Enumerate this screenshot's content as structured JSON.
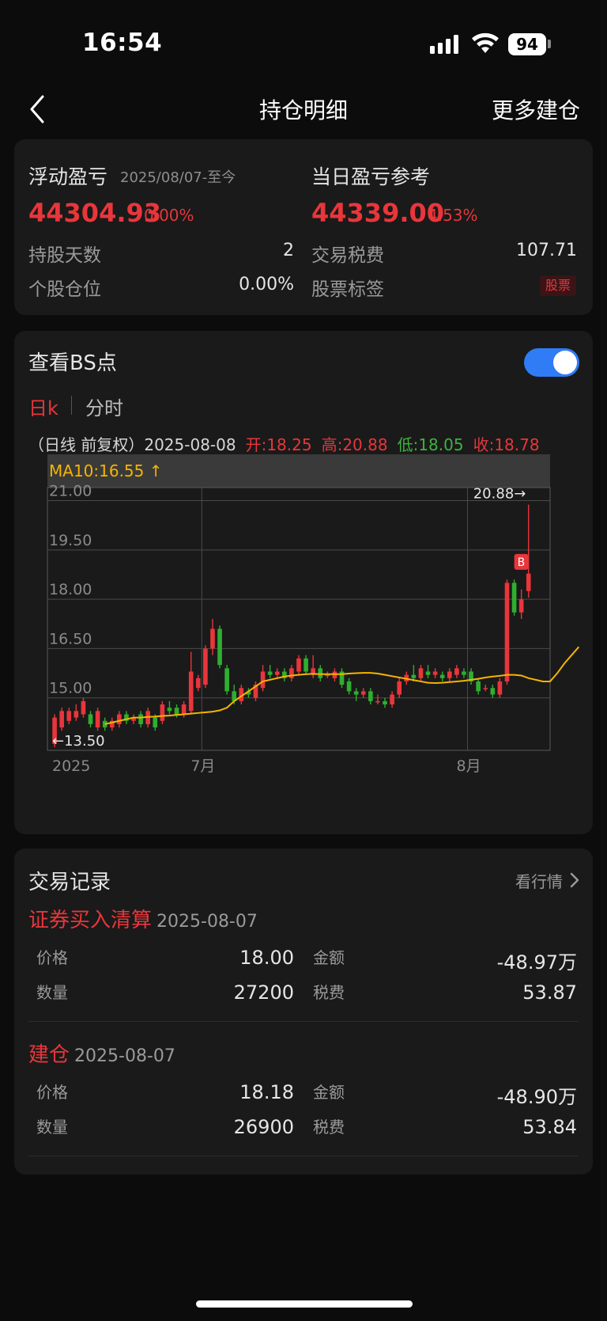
{
  "status": {
    "time": "16:54",
    "battery": "94"
  },
  "nav": {
    "title": "持仓明细",
    "right": "更多建仓"
  },
  "summary": {
    "floating_label": "浮动盈亏",
    "floating_since": "2025/08/07-至今",
    "floating_value": "44304.93",
    "floating_pct": "0.00%",
    "daily_label": "当日盈亏参考",
    "daily_value": "44339.00",
    "daily_pct": "4.53%",
    "hold_days_label": "持股天数",
    "hold_days_value": "2",
    "tax_label": "交易税费",
    "tax_value": "107.71",
    "position_label": "个股仓位",
    "position_value": "0.00%",
    "tag_label": "股票标签",
    "tag_value": "股票"
  },
  "bs": {
    "title": "查看BS点",
    "toggle_on": true,
    "tab_day": "日k",
    "tab_min": "分时",
    "ohlc_date": "（日线 前复权）2025-08-08",
    "open": "开:18.25",
    "high": "高:20.88",
    "low": "低:18.05",
    "close": "收:18.78"
  },
  "chart_data": {
    "type": "candlestick",
    "ma_label": "MA10:16.55 ↑",
    "y_ticks": [
      "21.00",
      "19.50",
      "18.00",
      "16.50",
      "15.00"
    ],
    "x_labels": [
      "2025",
      "7月",
      "8月"
    ],
    "ylim": [
      13.5,
      21.35
    ],
    "high_annotation": "20.88→",
    "low_annotation": "←13.50",
    "buy_marker": "B",
    "colors": {
      "up": "#e8363b",
      "down": "#2fae2f",
      "ma": "#f5b400"
    },
    "candles": [
      [
        13.6,
        14.4,
        13.5,
        14.5
      ],
      [
        14.1,
        14.6,
        14.0,
        14.7
      ],
      [
        14.3,
        14.6,
        14.2,
        14.7
      ],
      [
        14.4,
        14.6,
        14.3,
        14.8
      ],
      [
        14.5,
        14.9,
        14.4,
        15.0
      ],
      [
        14.5,
        14.2,
        14.1,
        14.6
      ],
      [
        14.1,
        14.6,
        14.0,
        14.7
      ],
      [
        14.3,
        14.1,
        14.0,
        14.4
      ],
      [
        14.1,
        14.3,
        14.0,
        14.4
      ],
      [
        14.2,
        14.5,
        14.1,
        14.6
      ],
      [
        14.5,
        14.3,
        14.2,
        14.6
      ],
      [
        14.3,
        14.4,
        14.2,
        14.5
      ],
      [
        14.5,
        14.2,
        14.1,
        14.6
      ],
      [
        14.2,
        14.6,
        14.1,
        14.7
      ],
      [
        14.4,
        14.1,
        14.0,
        14.5
      ],
      [
        14.3,
        14.8,
        14.2,
        14.9
      ],
      [
        14.7,
        14.6,
        14.5,
        14.9
      ],
      [
        14.7,
        14.5,
        14.4,
        14.8
      ],
      [
        14.5,
        14.8,
        14.4,
        14.9
      ],
      [
        14.6,
        15.8,
        14.5,
        16.4
      ],
      [
        15.3,
        15.6,
        15.2,
        15.7
      ],
      [
        15.4,
        16.5,
        15.3,
        16.6
      ],
      [
        16.5,
        17.1,
        16.3,
        17.4
      ],
      [
        17.1,
        16.0,
        15.9,
        17.2
      ],
      [
        15.9,
        15.2,
        15.1,
        16.0
      ],
      [
        15.2,
        14.9,
        14.8,
        15.4
      ],
      [
        14.9,
        15.3,
        14.8,
        15.4
      ],
      [
        15.2,
        15.1,
        15.0,
        15.3
      ],
      [
        15.0,
        15.4,
        14.9,
        15.5
      ],
      [
        15.3,
        15.8,
        15.2,
        16.0
      ],
      [
        15.8,
        15.7,
        15.6,
        16.0
      ],
      [
        15.7,
        15.8,
        15.6,
        15.9
      ],
      [
        15.8,
        15.6,
        15.5,
        15.9
      ],
      [
        15.6,
        15.9,
        15.5,
        16.0
      ],
      [
        15.8,
        16.2,
        15.7,
        16.3
      ],
      [
        16.2,
        15.8,
        15.7,
        16.3
      ],
      [
        15.7,
        15.9,
        15.6,
        16.3
      ],
      [
        15.9,
        15.6,
        15.5,
        16.0
      ],
      [
        15.7,
        15.7,
        15.6,
        15.8
      ],
      [
        15.6,
        15.8,
        15.5,
        15.9
      ],
      [
        15.8,
        15.4,
        15.3,
        15.9
      ],
      [
        15.5,
        15.2,
        15.1,
        15.6
      ],
      [
        15.2,
        15.1,
        14.9,
        15.3
      ],
      [
        15.1,
        15.2,
        15.0,
        15.3
      ],
      [
        15.2,
        14.9,
        14.8,
        15.3
      ],
      [
        14.9,
        14.9,
        14.8,
        15.1
      ],
      [
        14.9,
        14.8,
        14.7,
        15.0
      ],
      [
        14.8,
        15.1,
        14.7,
        15.2
      ],
      [
        15.1,
        15.5,
        15.0,
        15.6
      ],
      [
        15.5,
        15.7,
        15.4,
        15.8
      ],
      [
        15.7,
        15.6,
        15.5,
        16.0
      ],
      [
        15.6,
        15.9,
        15.5,
        16.0
      ],
      [
        15.8,
        15.7,
        15.6,
        16.0
      ],
      [
        15.7,
        15.8,
        15.6,
        15.9
      ],
      [
        15.7,
        15.6,
        15.5,
        15.8
      ],
      [
        15.6,
        15.8,
        15.5,
        15.9
      ],
      [
        15.7,
        15.9,
        15.6,
        16.0
      ],
      [
        15.8,
        15.7,
        15.6,
        15.9
      ],
      [
        15.8,
        15.5,
        15.4,
        15.9
      ],
      [
        15.5,
        15.2,
        15.1,
        15.6
      ],
      [
        15.3,
        15.3,
        15.2,
        15.4
      ],
      [
        15.3,
        15.1,
        15.0,
        15.4
      ],
      [
        15.1,
        15.5,
        15.0,
        15.6
      ],
      [
        15.5,
        18.5,
        15.4,
        18.6
      ],
      [
        18.5,
        17.6,
        17.5,
        18.6
      ],
      [
        17.6,
        18.0,
        17.4,
        18.3
      ],
      [
        18.25,
        18.78,
        18.05,
        20.88
      ]
    ],
    "ma10": [
      14.2,
      14.25,
      14.3,
      14.35,
      14.4,
      14.4,
      14.42,
      14.43,
      14.45,
      14.46,
      14.48,
      14.5,
      14.52,
      14.54,
      14.56,
      14.58,
      14.62,
      14.7,
      14.9,
      15.05,
      15.2,
      15.35,
      15.5,
      15.55,
      15.6,
      15.65,
      15.68,
      15.7,
      15.72,
      15.73,
      15.72,
      15.72,
      15.72,
      15.72,
      15.74,
      15.75,
      15.76,
      15.76,
      15.74,
      15.7,
      15.66,
      15.62,
      15.58,
      15.54,
      15.5,
      15.46,
      15.45,
      15.46,
      15.48,
      15.5,
      15.52,
      15.55,
      15.58,
      15.62,
      15.65,
      15.67,
      15.7,
      15.7,
      15.68,
      15.6,
      15.55,
      15.5,
      15.5,
      15.75,
      16.05,
      16.3,
      16.55
    ]
  },
  "records": {
    "title": "交易记录",
    "more": "看行情",
    "items": [
      {
        "type": "证券买入清算",
        "date": "2025-08-07",
        "price_label": "价格",
        "price": "18.00",
        "amount_label": "金额",
        "amount": "-48.97万",
        "qty_label": "数量",
        "qty": "27200",
        "fee_label": "税费",
        "fee": "53.87"
      },
      {
        "type": "建仓",
        "date": "2025-08-07",
        "price_label": "价格",
        "price": "18.18",
        "amount_label": "金额",
        "amount": "-48.90万",
        "qty_label": "数量",
        "qty": "26900",
        "fee_label": "税费",
        "fee": "53.84"
      }
    ]
  }
}
